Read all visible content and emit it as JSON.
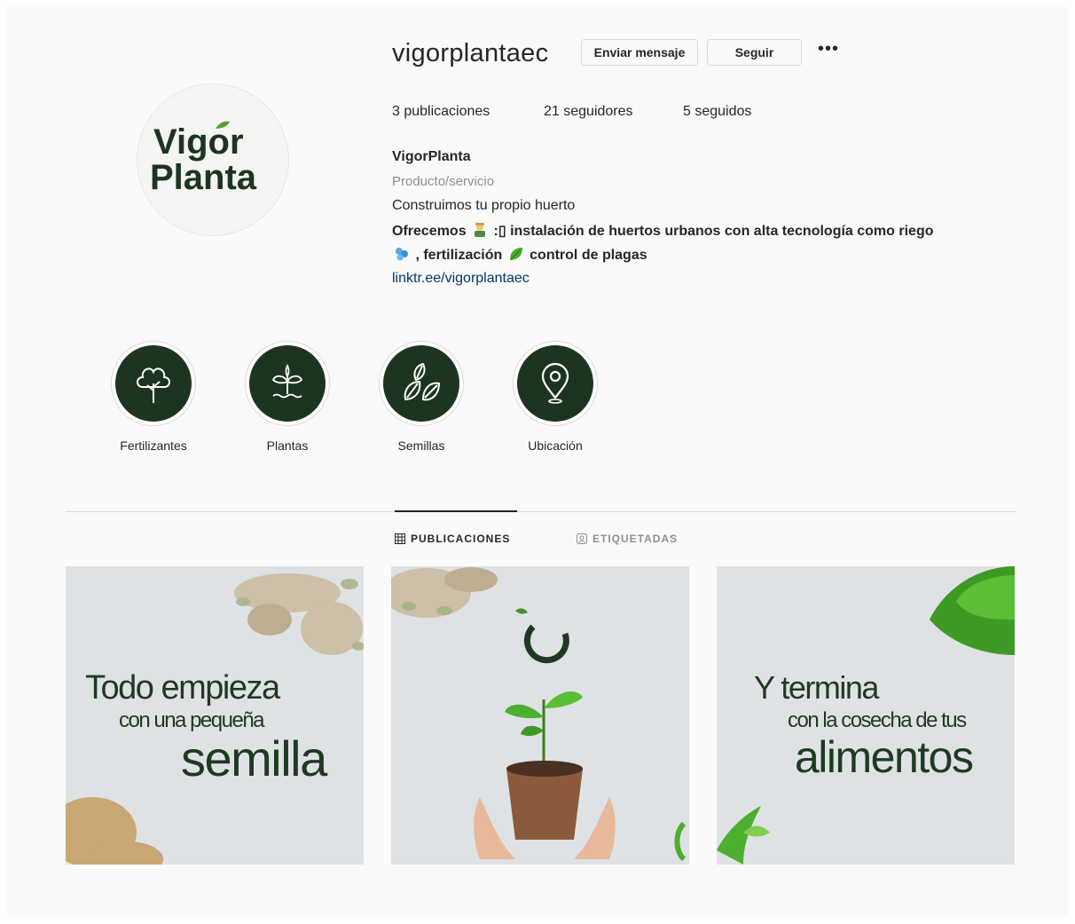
{
  "profile": {
    "username": "vigorplantaec",
    "message_button": "Enviar mensaje",
    "follow_button": "Seguir",
    "more_label": "•••",
    "avatar_text_line1": "Vigor",
    "avatar_text_line2": "Planta",
    "stats": {
      "posts": "3 publicaciones",
      "followers": "21 seguidores",
      "following": "5 seguidos"
    },
    "bio": {
      "name": "VigorPlanta",
      "category": "Producto/servicio",
      "line1": "Construimos tu propio huerto",
      "line2_a": "Ofrecemos",
      "line2_b": ":▯ instalación de huertos urbanos con alta tecnología como riego",
      "line3_a": ", fertilización",
      "line3_b": "control de plagas",
      "link": "linktr.ee/vigorplantaec"
    }
  },
  "highlights": [
    {
      "label": "Fertilizantes",
      "icon": "tree-icon"
    },
    {
      "label": "Plantas",
      "icon": "sprout-icon"
    },
    {
      "label": "Semillas",
      "icon": "leaves-icon"
    },
    {
      "label": "Ubicación",
      "icon": "location-pin-icon"
    }
  ],
  "tabs": {
    "posts": "PUBLICACIONES",
    "tagged": "ETIQUETADAS"
  },
  "posts": [
    {
      "line1": "Todo empieza",
      "line2": "con una pequeña",
      "line3": "semilla"
    },
    {
      "description": "plant-in-pot"
    },
    {
      "line1": "Y termina",
      "line2": "con la cosecha de tus",
      "line3": "alimentos"
    }
  ],
  "colors": {
    "brand_green": "#1d3520",
    "link": "#00376b",
    "muted": "#8e8e8e"
  }
}
